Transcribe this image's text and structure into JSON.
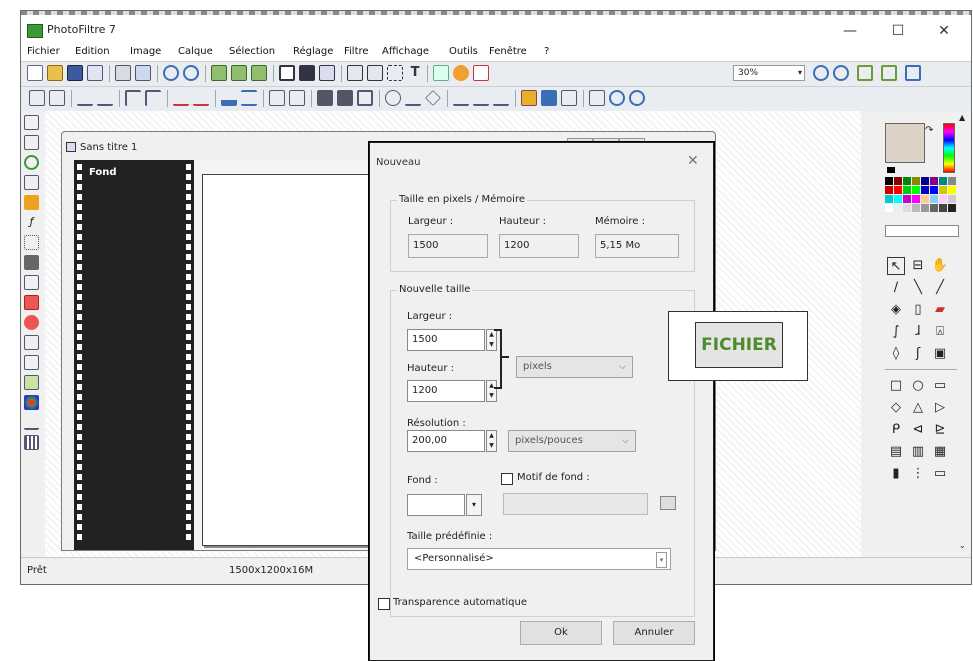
{
  "app": {
    "title": "PhotoFiltre 7",
    "minimize": "—",
    "maximize": "☐",
    "close": "✕"
  },
  "menu": [
    "Fichier",
    "Edition",
    "Image",
    "Calque",
    "Sélection",
    "Réglage",
    "Filtre",
    "Affichage",
    "Outils",
    "Fenêtre",
    "?"
  ],
  "toolbar": {
    "zoom": "30%",
    "zoom_arrow": "▾"
  },
  "document": {
    "title": "Sans titre 1",
    "layer": "Fond"
  },
  "status": {
    "ready": "Prêt",
    "size": "1500x1200x16M"
  },
  "dialog": {
    "title": "Nouveau",
    "close": "✕",
    "memory_group": "Taille en pixels / Mémoire",
    "width_label": "Largeur :",
    "height_label": "Hauteur :",
    "memory_label": "Mémoire :",
    "width_value": "1500",
    "height_value": "1200",
    "memory_value": "5,15 Mo",
    "new_size_group": "Nouvelle taille",
    "new_width_label": "Largeur :",
    "new_width": "1500",
    "new_height_label": "Hauteur :",
    "new_height": "1200",
    "unit": "pixels",
    "resolution_label": "Résolution :",
    "resolution": "200,00",
    "resolution_unit": "pixels/pouces",
    "background_label": "Fond :",
    "pattern_label": "Motif de fond :",
    "preset_label": "Taille prédéfinie :",
    "preset": "<Personnalisé>",
    "auto_transparency": "Transparence automatique",
    "ok": "Ok",
    "cancel": "Annuler",
    "combo_arrow": "⌵",
    "spin_up": "▲",
    "spin_down": "▼"
  },
  "annotation": {
    "label": "FICHIER",
    "color": "#4f8a2c"
  }
}
